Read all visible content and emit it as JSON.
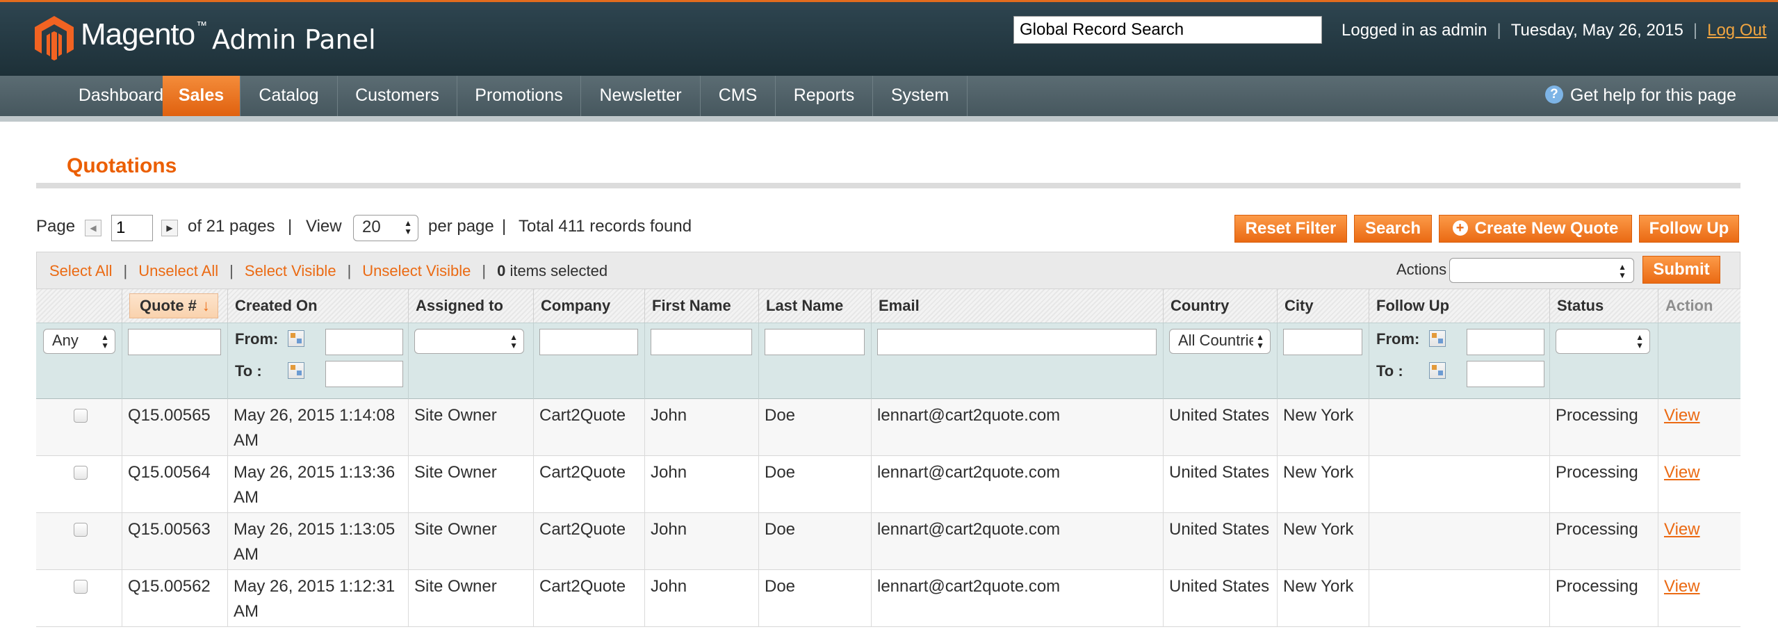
{
  "header": {
    "logo_text": "Magento",
    "logo_tm": "™",
    "logo_panel": "Admin Panel",
    "global_search_placeholder": "Global Record Search",
    "logged_in": "Logged in as admin",
    "date": "Tuesday, May 26, 2015",
    "logout": "Log Out"
  },
  "nav": {
    "items": [
      "Dashboard",
      "Sales",
      "Catalog",
      "Customers",
      "Promotions",
      "Newsletter",
      "CMS",
      "Reports",
      "System"
    ],
    "active": "Sales",
    "help": "Get help for this page"
  },
  "page": {
    "title": "Quotations"
  },
  "pager": {
    "page_label": "Page",
    "page_value": "1",
    "of_pages": "of 21 pages",
    "sep": "|",
    "view_label": "View",
    "per_page_value": "20",
    "per_page_label": "per page",
    "total": "Total 411 records found"
  },
  "buttons": {
    "reset_filter": "Reset Filter",
    "search": "Search",
    "create_new_quote": "Create New Quote",
    "follow_up": "Follow Up",
    "submit": "Submit"
  },
  "massaction": {
    "select_all": "Select All",
    "unselect_all": "Unselect All",
    "select_visible": "Select Visible",
    "unselect_visible": "Unselect Visible",
    "selected_count": "0",
    "selected_suffix": "items selected",
    "actions_label": "Actions"
  },
  "grid": {
    "columns": [
      "",
      "Quote #",
      "Created On",
      "Assigned to",
      "Company",
      "First Name",
      "Last Name",
      "Email",
      "Country",
      "City",
      "Follow Up",
      "Status",
      "Action"
    ],
    "sort_column": "Quote #",
    "filters": {
      "any": "Any",
      "from_label": "From:",
      "to_label": "To :",
      "country": "All Countries"
    },
    "rows": [
      {
        "quote": "Q15.00565",
        "created_line1": "May 26, 2015 1:14:08",
        "created_line2": "AM",
        "assigned": "Site Owner",
        "company": "Cart2Quote",
        "first": "John",
        "last": "Doe",
        "email": "lennart@cart2quote.com",
        "country": "United States",
        "city": "New York",
        "followup": "",
        "status": "Processing",
        "action": "View"
      },
      {
        "quote": "Q15.00564",
        "created_line1": "May 26, 2015 1:13:36",
        "created_line2": "AM",
        "assigned": "Site Owner",
        "company": "Cart2Quote",
        "first": "John",
        "last": "Doe",
        "email": "lennart@cart2quote.com",
        "country": "United States",
        "city": "New York",
        "followup": "",
        "status": "Processing",
        "action": "View"
      },
      {
        "quote": "Q15.00563",
        "created_line1": "May 26, 2015 1:13:05",
        "created_line2": "AM",
        "assigned": "Site Owner",
        "company": "Cart2Quote",
        "first": "John",
        "last": "Doe",
        "email": "lennart@cart2quote.com",
        "country": "United States",
        "city": "New York",
        "followup": "",
        "status": "Processing",
        "action": "View"
      },
      {
        "quote": "Q15.00562",
        "created_line1": "May 26, 2015 1:12:31",
        "created_line2": "AM",
        "assigned": "Site Owner",
        "company": "Cart2Quote",
        "first": "John",
        "last": "Doe",
        "email": "lennart@cart2quote.com",
        "country": "United States",
        "city": "New York",
        "followup": "",
        "status": "Processing",
        "action": "View"
      }
    ]
  },
  "colors": {
    "accent": "#eb6a13",
    "header_bg": "#1d3038",
    "filter_bg": "#d9e7e7"
  }
}
